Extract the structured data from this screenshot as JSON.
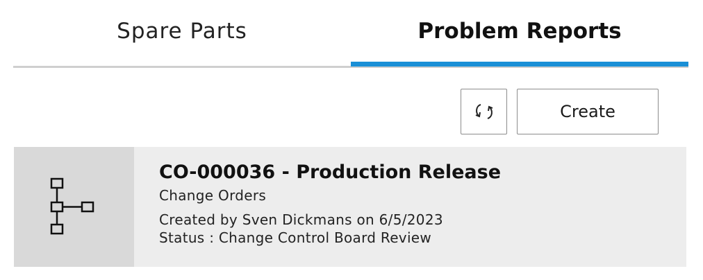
{
  "tabs": [
    {
      "label": "Spare Parts",
      "active": false
    },
    {
      "label": "Problem Reports",
      "active": true
    }
  ],
  "accent_color": "#1a8fd6",
  "toolbar": {
    "refresh_icon": "refresh-icon",
    "create_label": "Create"
  },
  "cards": [
    {
      "icon": "hierarchy-structure-icon",
      "title": "CO-000036 - Production Release",
      "type": "Change Orders",
      "created": "Created by Sven Dickmans on 6/5/2023",
      "status": "Status : Change Control Board Review"
    }
  ]
}
